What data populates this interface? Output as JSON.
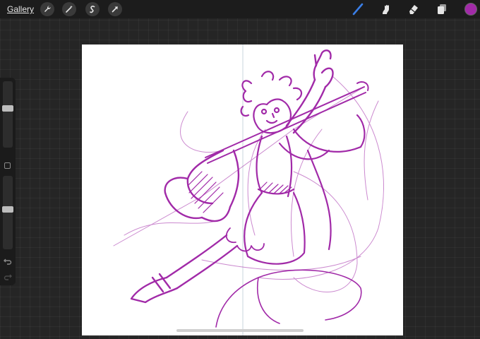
{
  "toolbar": {
    "gallery_label": "Gallery",
    "left_tools": [
      "wrench-icon",
      "magic-wand-icon",
      "selection-icon",
      "transform-arrow-icon"
    ],
    "right_tools": [
      "brush-icon",
      "smudge-icon",
      "eraser-icon",
      "layers-icon"
    ],
    "active_tool": "brush-icon",
    "current_color": "#a12aa8",
    "brush_accent": "#3a7ee6"
  },
  "sidebar": {
    "brush_size_level": 0.6,
    "opacity_level": 0.55,
    "controls": [
      "modify-button",
      "undo-icon",
      "redo-icon"
    ]
  },
  "canvas": {
    "background": "#ffffff",
    "stroke_color": "#a12aa8",
    "guide_line": "vertical-symmetry-guide"
  }
}
